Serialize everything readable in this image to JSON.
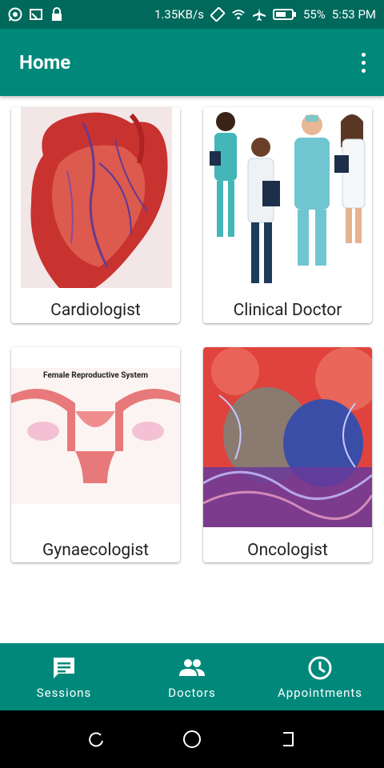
{
  "status_bar": {
    "speed": "1.35KB/s",
    "battery": "55%",
    "time": "5:53 PM"
  },
  "app_bar": {
    "title": "Home"
  },
  "cards": [
    {
      "label": "Cardiologist"
    },
    {
      "label": "Clinical Doctor"
    },
    {
      "label": "Gynaecologist",
      "image_caption": "Female Reproductive System"
    },
    {
      "label": "Oncologist"
    }
  ],
  "bottom_nav": {
    "items": [
      {
        "label": "Sessions",
        "icon": "chat-icon"
      },
      {
        "label": "Doctors",
        "icon": "people-icon"
      },
      {
        "label": "Appointments",
        "icon": "clock-icon"
      }
    ]
  },
  "colors": {
    "status_bar": "#00695c",
    "primary": "#00897b",
    "system_nav": "#000000"
  }
}
